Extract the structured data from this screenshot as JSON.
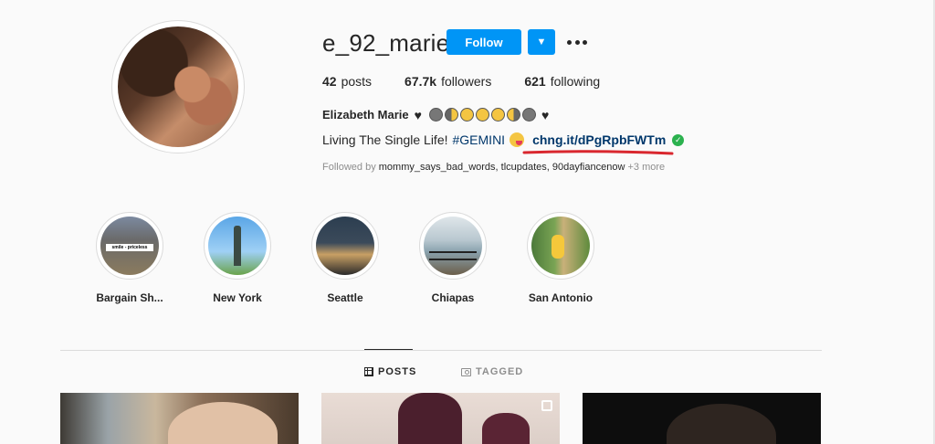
{
  "profile": {
    "username": "e_92_marie",
    "follow_label": "Follow",
    "stats": {
      "posts_count": "42",
      "posts_label": "posts",
      "followers_count": "67.7k",
      "followers_label": "followers",
      "following_count": "621",
      "following_label": "following"
    },
    "full_name": "Elizabeth Marie",
    "bio_text": "Living The Single Life!",
    "bio_hashtag": "#GEMINI",
    "bio_link": "chng.it/dPgRpbFWTm",
    "followed_by_prefix": "Followed by",
    "followed_by_names": "mommy_says_bad_words, tlcupdates, 90dayfiancenow",
    "followed_by_more": "+3 more"
  },
  "highlights": [
    {
      "label": "Bargain Sh...",
      "sticker": "smile - priceless"
    },
    {
      "label": "New York"
    },
    {
      "label": "Seattle"
    },
    {
      "label": "Chiapas"
    },
    {
      "label": "San Antonio"
    }
  ],
  "tabs": {
    "posts": "POSTS",
    "tagged": "TAGGED"
  },
  "colors": {
    "primary_blue": "#0095f6",
    "link_blue": "#00376b",
    "verified_green": "#2bb14e",
    "annotation_red": "#d9272e"
  },
  "icons": [
    "chevron-down-icon",
    "more-options-icon",
    "black-heart-icon",
    "moon-phase-icon",
    "verified-check-icon",
    "grid-icon",
    "tagged-icon",
    "multi-post-icon"
  ]
}
